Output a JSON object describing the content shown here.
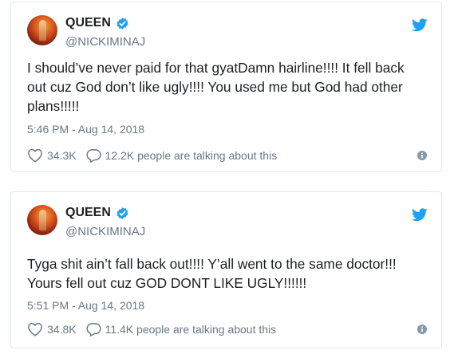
{
  "tweets": [
    {
      "display_name": "QUEEN",
      "handle": "@NICKIMINAJ",
      "text": "I should’ve never paid for that gyatDamn hairline!!!! It fell back out cuz God don’t like ugly!!!! You used me but God had other plans!!!!!",
      "timestamp": "5:46 PM - Aug 14, 2018",
      "likes": "34.3K",
      "talking": "12.2K people are talking about this"
    },
    {
      "display_name": "QUEEN",
      "handle": "@NICKIMINAJ",
      "text": "Tyga shit ain’t fall back out!!!! Y’all went to the same doctor!!! Yours fell out cuz GOD DONT LIKE UGLY!!!!!!",
      "timestamp": "5:51 PM - Aug 14, 2018",
      "likes": "34.8K",
      "talking": "11.4K people are talking about this"
    }
  ],
  "colors": {
    "twitter_blue": "#1da1f2",
    "muted_text": "#697882",
    "border": "#e1e8ed"
  },
  "icons": [
    "avatar",
    "verified-badge-icon",
    "twitter-bird-icon",
    "heart-icon",
    "reply-bubble-icon",
    "info-icon"
  ]
}
